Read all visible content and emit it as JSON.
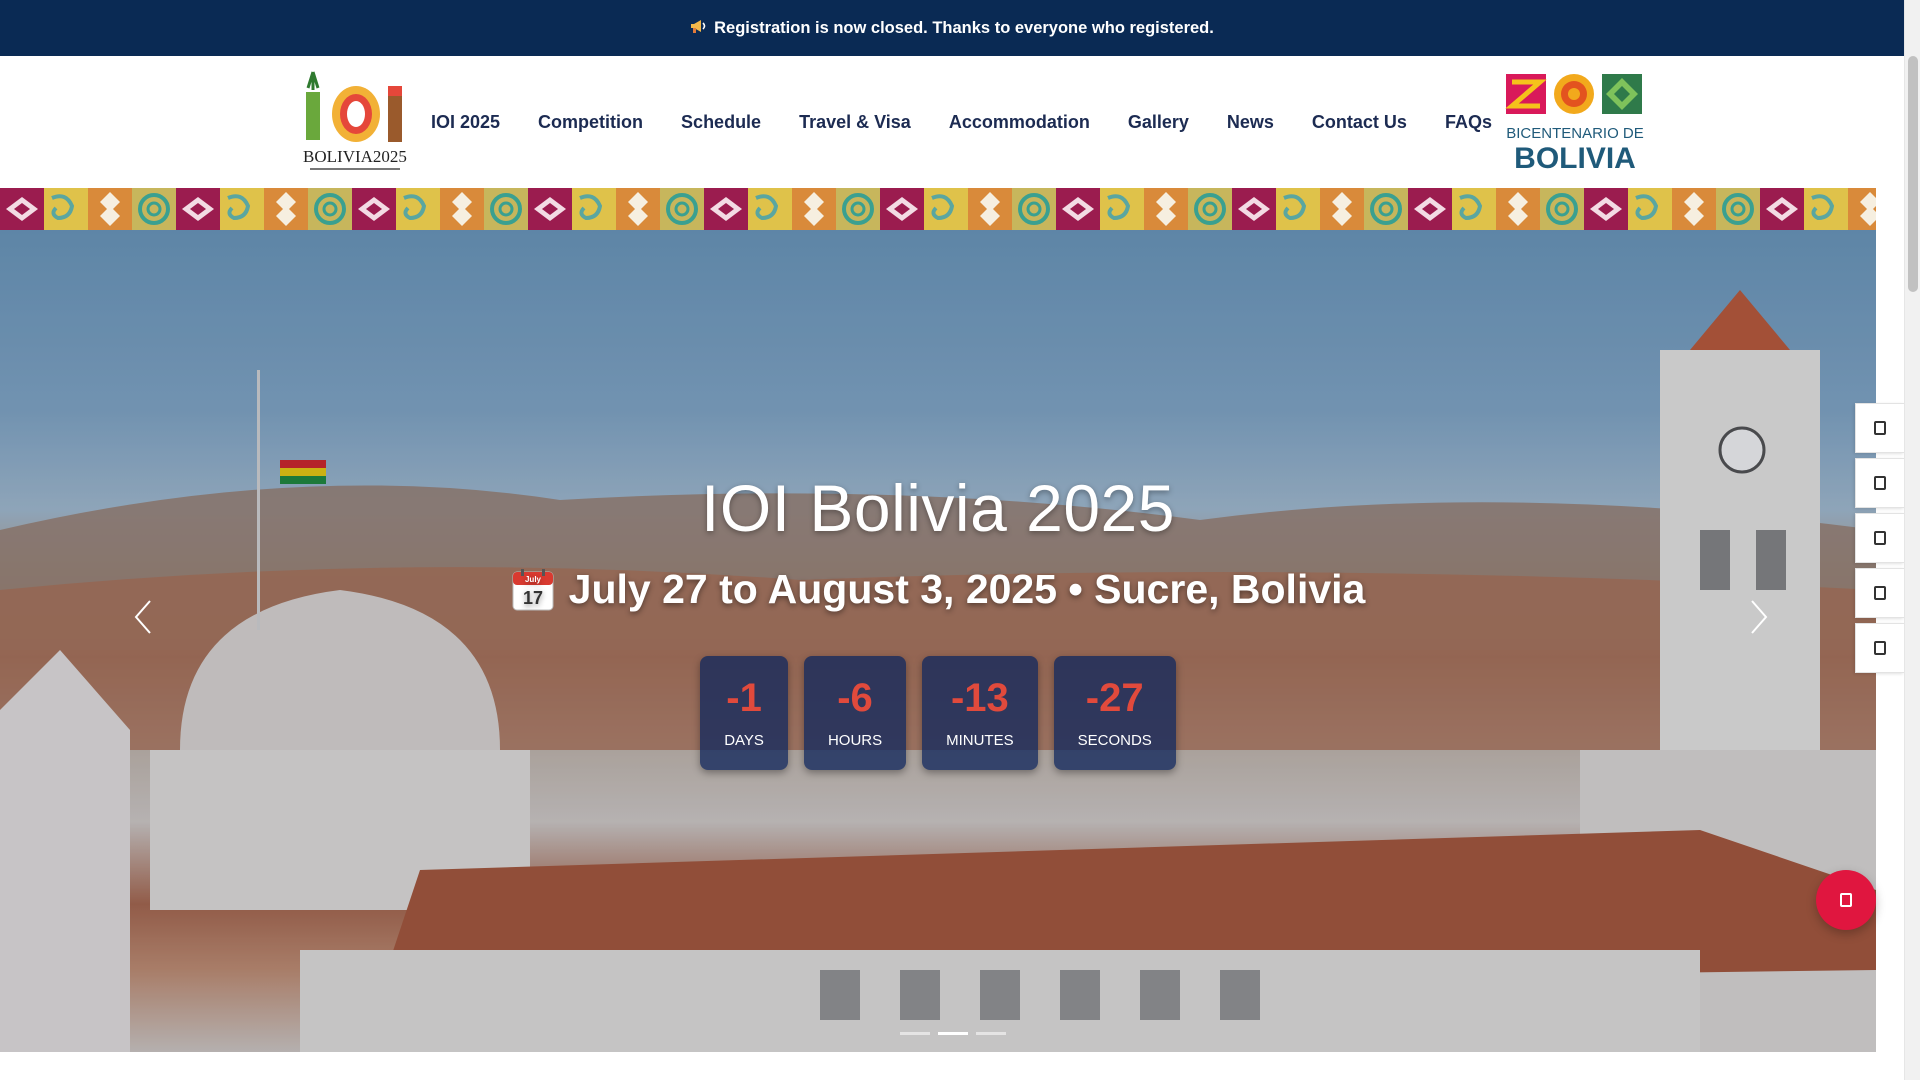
{
  "announcement": {
    "icon": "megaphone-icon",
    "text": "Registration is now closed. Thanks to everyone who registered."
  },
  "header": {
    "nav": [
      "IOI 2025",
      "Competition",
      "Schedule",
      "Travel & Visa",
      "Accommodation",
      "Gallery",
      "News",
      "Contact Us",
      "FAQs"
    ],
    "logo_ioi": {
      "text": "BOLIVIA2025"
    },
    "logo_bicentenario": {
      "line1": "BICENTENARIO DE",
      "line2": "BOLIVIA"
    }
  },
  "hero": {
    "title": "IOI Bolivia 2025",
    "calendar": {
      "month": "July",
      "day": "17"
    },
    "subtitle": "July 27 to August 3, 2025 • Sucre, Bolivia",
    "countdown": [
      {
        "value": "-1",
        "label": "DAYS"
      },
      {
        "value": "-6",
        "label": "HOURS"
      },
      {
        "value": "-13",
        "label": "MINUTES"
      },
      {
        "value": "-27",
        "label": "SECONDS"
      }
    ],
    "slides_count": 3,
    "active_slide": 2
  },
  "social_rail": [
    "social-link-1",
    "social-link-2",
    "social-link-3",
    "social-link-4",
    "social-link-5"
  ],
  "colors": {
    "topbar": "#0a2a54",
    "nav_text": "#1c2b52",
    "countdown_number": "#e14a3c",
    "countdown_box": "#12285c",
    "fab": "#e0163f"
  }
}
